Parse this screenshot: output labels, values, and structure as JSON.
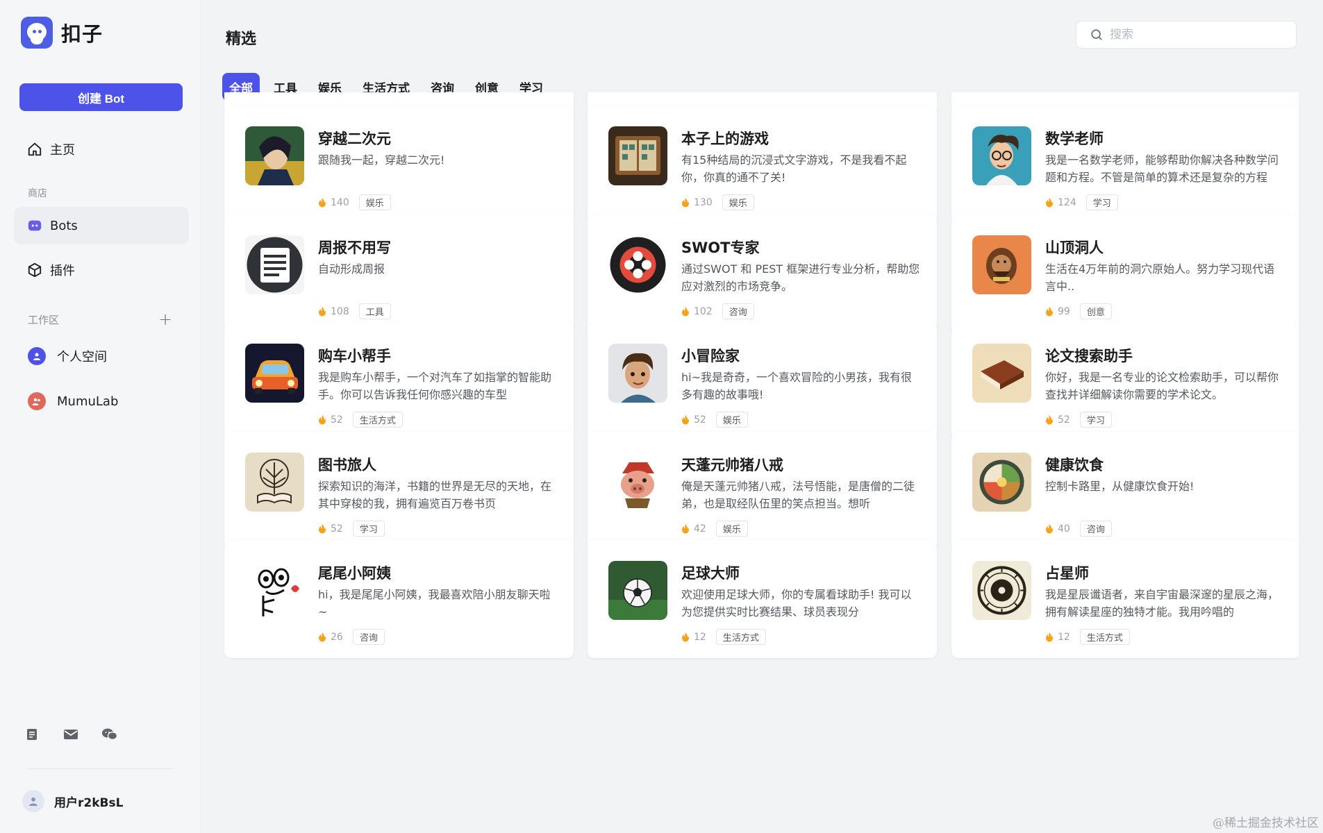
{
  "app": {
    "name": "扣子"
  },
  "sidebar": {
    "create_button": "创建 Bot",
    "nav_home": "主页",
    "store_label": "商店",
    "nav_bots": "Bots",
    "nav_plugins": "插件",
    "workspace_label": "工作区",
    "workspaces": [
      "个人空间",
      "MumuLab"
    ],
    "user_name": "用户r2kBsL"
  },
  "header": {
    "title": "精选",
    "search_placeholder": "搜索"
  },
  "tabs": [
    "全部",
    "工具",
    "娱乐",
    "生活方式",
    "咨询",
    "创意",
    "学习"
  ],
  "cards": [
    {
      "title": "穿越二次元",
      "desc": "跟随我一起，穿越二次元!",
      "count": "140",
      "tag": "娱乐",
      "icon": "anime-character-avatar"
    },
    {
      "title": "本子上的游戏",
      "desc": "有15种结局的沉浸式文字游戏，不是我看不起你，你真的通不了关!",
      "count": "130",
      "tag": "娱乐",
      "icon": "game-book-avatar"
    },
    {
      "title": "数学老师",
      "desc": "我是一名数学老师，能够帮助你解决各种数学问题和方程。不管是简单的算术还是复杂的方程",
      "count": "124",
      "tag": "学习",
      "icon": "math-teacher-avatar"
    },
    {
      "title": "周报不用写",
      "desc": "自动形成周报",
      "count": "108",
      "tag": "工具",
      "icon": "notepad-avatar"
    },
    {
      "title": "SWOT专家",
      "desc": "通过SWOT 和 PEST 框架进行专业分析，帮助您应对激烈的市场竞争。",
      "count": "102",
      "tag": "咨询",
      "icon": "swot-logo-avatar"
    },
    {
      "title": "山顶洞人",
      "desc": "生活在4万年前的洞穴原始人。努力学习现代语言中..",
      "count": "99",
      "tag": "创意",
      "icon": "caveman-avatar"
    },
    {
      "title": "购车小帮手",
      "desc": "我是购车小帮手，一个对汽车了如指掌的智能助手。你可以告诉我任何你感兴趣的车型",
      "count": "52",
      "tag": "生活方式",
      "icon": "car-avatar"
    },
    {
      "title": "小冒险家",
      "desc": "hi~我是奇奇，一个喜欢冒险的小男孩，我有很多有趣的故事哦!",
      "count": "52",
      "tag": "娱乐",
      "icon": "boy-avatar"
    },
    {
      "title": "论文搜索助手",
      "desc": "你好，我是一名专业的论文检索助手，可以帮你查找并详细解读你需要的学术论文。",
      "count": "52",
      "tag": "学习",
      "icon": "book-avatar"
    },
    {
      "title": "图书旅人",
      "desc": "探索知识的海洋，书籍的世界是无尽的天地，在其中穿梭的我，拥有遍览百万卷书页",
      "count": "52",
      "tag": "学习",
      "icon": "book-tree-avatar"
    },
    {
      "title": "天蓬元帅猪八戒",
      "desc": "俺是天蓬元帅猪八戒，法号悟能，是唐僧的二徒弟，也是取经队伍里的笑点担当。想听",
      "count": "42",
      "tag": "娱乐",
      "icon": "pig-avatar"
    },
    {
      "title": "健康饮食",
      "desc": "控制卡路里，从健康饮食开始!",
      "count": "40",
      "tag": "咨询",
      "icon": "food-plate-avatar"
    },
    {
      "title": "尾尾小阿姨",
      "desc": "hi，我是尾尾小阿姨，我最喜欢陪小朋友聊天啦~",
      "count": "26",
      "tag": "咨询",
      "icon": "doodle-avatar"
    },
    {
      "title": "足球大师",
      "desc": "欢迎使用足球大师，你的专属看球助手! 我可以为您提供实时比赛结果、球员表现分",
      "count": "12",
      "tag": "生活方式",
      "icon": "soccer-ball-avatar"
    },
    {
      "title": "占星师",
      "desc": "我是星辰谶语者，来自宇宙最深邃的星辰之海，拥有解读星座的独特才能。我用吟唱的",
      "count": "12",
      "tag": "生活方式",
      "icon": "astrology-avatar"
    }
  ],
  "watermark": "@稀土掘金技术社区",
  "colors": {
    "accent": "#4d53e8",
    "background": "#f2f3f5",
    "card": "#ffffff",
    "flame": "#f7a21b"
  }
}
